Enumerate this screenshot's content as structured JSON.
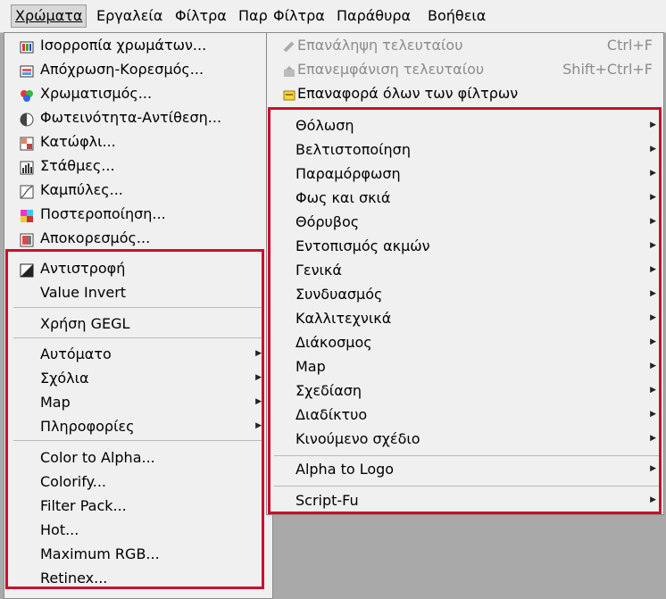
{
  "menubar": {
    "items": [
      "Χρώματα",
      "Εργαλεία",
      "Φίλτρα",
      "Παρ",
      "Φίλτρα",
      "Παράθυρα",
      "Βοήθεια"
    ]
  },
  "colors_menu": {
    "top_items": [
      {
        "label": "Ισορροπία χρωμάτων...",
        "icon": "color-balance-icon"
      },
      {
        "label": "Απόχρωση-Κορεσμός...",
        "icon": "hue-saturation-icon"
      },
      {
        "label": "Χρωματισμός...",
        "icon": "colorize-icon"
      },
      {
        "label": "Φωτεινότητα-Αντίθεση...",
        "icon": "brightness-contrast-icon"
      },
      {
        "label": "Κατώφλι...",
        "icon": "threshold-icon"
      },
      {
        "label": "Στάθμες...",
        "icon": "levels-icon"
      },
      {
        "label": "Καμπύλες...",
        "icon": "curves-icon"
      },
      {
        "label": "Ποστεροποίηση...",
        "icon": "posterize-icon"
      },
      {
        "label": "Αποκορεσμός...",
        "icon": "desaturate-icon"
      }
    ],
    "group1": [
      {
        "label": "Αντιστροφή",
        "icon": "invert-icon"
      },
      {
        "label": "Value Invert"
      }
    ],
    "group2": [
      {
        "label": "Χρήση GEGL"
      }
    ],
    "group3": [
      {
        "label": "Αυτόματο"
      },
      {
        "label": "Σχόλια"
      },
      {
        "label": "Map"
      },
      {
        "label": "Πληροφορίες"
      }
    ],
    "group4": [
      {
        "label": "Color to Alpha..."
      },
      {
        "label": "Colorify..."
      },
      {
        "label": "Filter Pack..."
      },
      {
        "label": "Hot..."
      },
      {
        "label": "Maximum RGB..."
      },
      {
        "label": "Retinex..."
      }
    ]
  },
  "filters_menu": {
    "top_items": [
      {
        "label": "Επανάληψη τελευταίου",
        "shortcut": "Ctrl+F",
        "disabled": true,
        "icon": "repeat-icon"
      },
      {
        "label": "Επανεμφάνιση τελευταίου",
        "shortcut": "Shift+Ctrl+F",
        "disabled": true,
        "icon": "reshow-icon"
      },
      {
        "label": "Επαναφορά όλων των φίλτρων",
        "icon": "reset-filters-icon"
      }
    ],
    "categories": [
      "Θόλωση",
      "Βελτιστοποίηση",
      "Παραμόρφωση",
      "Φως και σκιά",
      "Θόρυβος",
      "Εντοπισμός ακμών",
      "Γενικά",
      "Συνδυασμός",
      "Καλλιτεχνικά",
      "Διάκοσμος",
      "Map",
      "Σχεδίαση",
      "Διαδίκτυο",
      "Κινούμενο σχέδιο"
    ],
    "alpha_to_logo": "Alpha to Logo",
    "script_fu": "Script-Fu"
  },
  "highlight_color": "#c8102e"
}
